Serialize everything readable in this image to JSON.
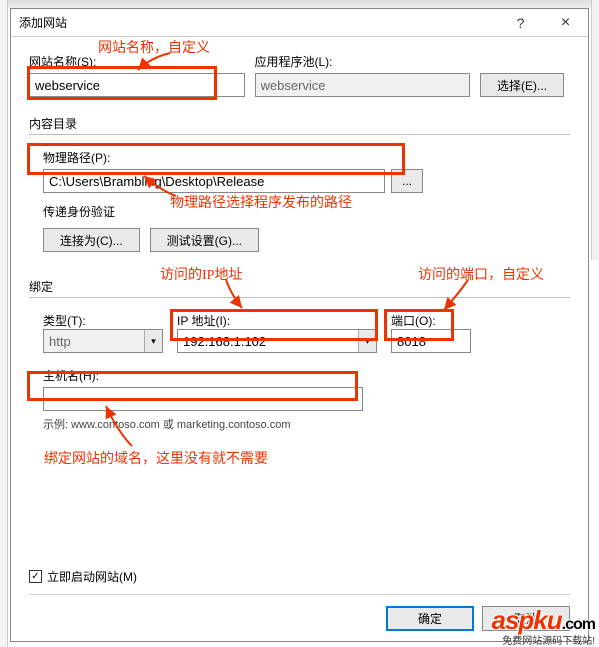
{
  "window": {
    "title": "添加网站",
    "help": "?",
    "close": "×"
  },
  "site": {
    "name_label": "网站名称(S):",
    "name_value": "webservice",
    "pool_label": "应用程序池(L):",
    "pool_value": "webservice",
    "select_btn": "选择(E)..."
  },
  "content_dir": {
    "group_title": "内容目录",
    "path_label": "物理路径(P):",
    "path_value": "C:\\Users\\Brambling\\Desktop\\Release",
    "browse": "...",
    "auth_label": "传递身份验证",
    "connect_btn": "连接为(C)...",
    "test_btn": "测试设置(G)..."
  },
  "binding": {
    "group_title": "绑定",
    "type_label": "类型(T):",
    "type_value": "http",
    "ip_label": "IP 地址(I):",
    "ip_value": "192.168.1.102",
    "port_label": "端口(O):",
    "port_value": "8018",
    "host_label": "主机名(H):",
    "host_value": "",
    "example": "示例: www.contoso.com 或 marketing.contoso.com"
  },
  "start_site": {
    "label": "立即启动网站(M)",
    "checked": "✓"
  },
  "footer": {
    "ok": "确定",
    "cancel": "取消"
  },
  "annotations": {
    "a1": "网站名称，自定义",
    "a2": "物理路径选择程序发布的路径",
    "a3": "访问的IP地址",
    "a4": "访问的端口，自定义",
    "a5": "绑定网站的域名，这里没有就不需要"
  },
  "watermark": {
    "brand": "aspku",
    "dotcom": ".com",
    "sub": "免费网站源码下载站!"
  }
}
